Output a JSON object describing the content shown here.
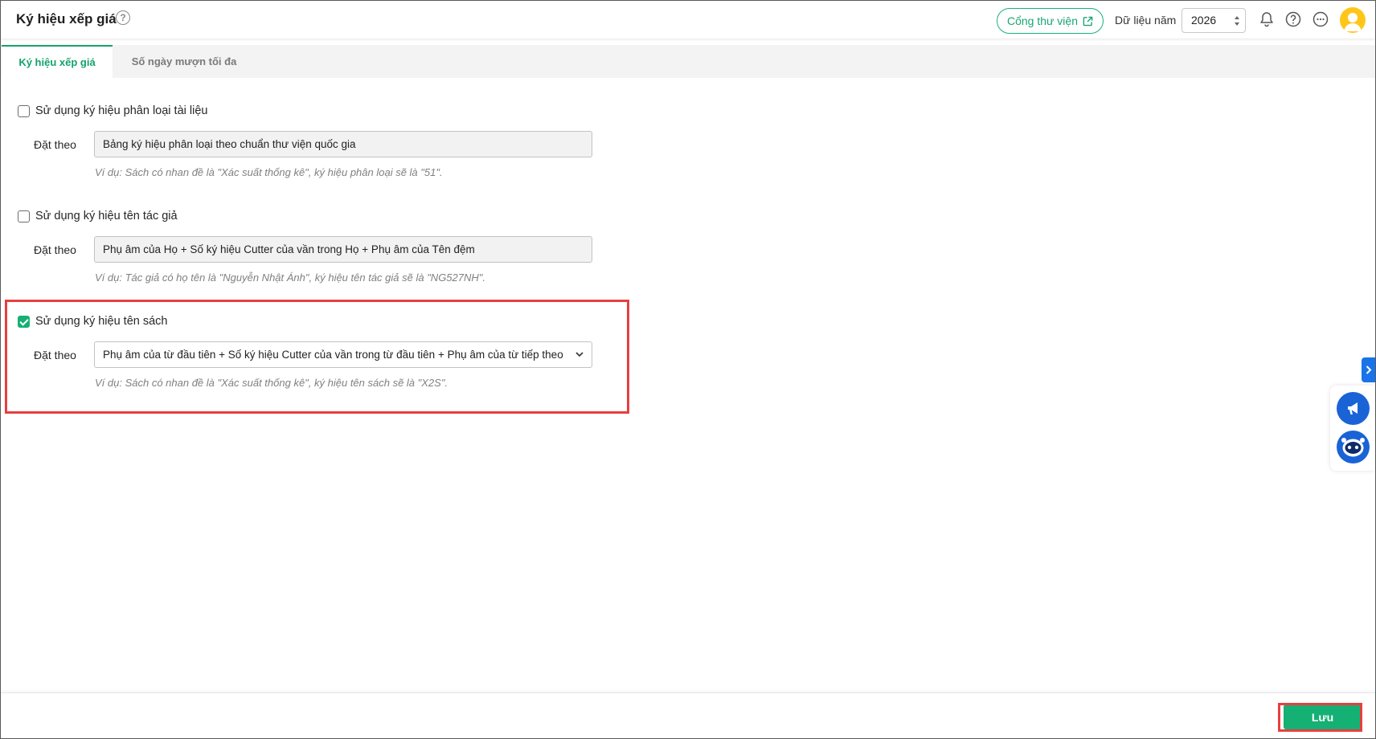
{
  "header": {
    "title": "Ký hiệu xếp giá",
    "help_symbol": "?",
    "portal_button": "Cổng thư viện",
    "year_label": "Dữ liệu năm",
    "year_value": "2026"
  },
  "tabs": [
    {
      "label": "Ký hiệu xếp giá",
      "active": true
    },
    {
      "label": "Số ngày mượn tối đa",
      "active": false
    }
  ],
  "sections": [
    {
      "checkbox_label": "Sử dụng ký hiệu phân loại tài liệu",
      "checked": false,
      "field_label": "Đặt theo",
      "field_value": "Bảng ký hiệu phân loại theo chuẩn thư viện quốc gia",
      "example": "Ví dụ: Sách có nhan đề là \"Xác suất thống kê\", ký hiệu phân loại sẽ là \"51\"."
    },
    {
      "checkbox_label": "Sử dụng ký hiệu tên tác giả",
      "checked": false,
      "field_label": "Đặt theo",
      "field_value": "Phụ âm của Họ + Số ký hiệu Cutter của vần trong Họ + Phụ âm của Tên đệm",
      "example": "Ví dụ: Tác giả có họ tên là \"Nguyễn Nhật Ánh\", ký hiệu tên tác giả sẽ là \"NG527NH\"."
    },
    {
      "checkbox_label": "Sử dụng ký hiệu tên sách",
      "checked": true,
      "field_label": "Đặt theo",
      "field_value": "Phụ âm của từ đầu tiên + Số ký hiệu Cutter của vần trong từ đầu tiên + Phụ âm của từ tiếp theo",
      "example": "Ví dụ: Sách có nhan đề là \"Xác suất thống kê\", ký hiệu tên sách sẽ là \"X2S\"."
    }
  ],
  "footer": {
    "save_label": "Lưu"
  },
  "colors": {
    "accent": "#14b074",
    "highlight": "#e83f3f",
    "side_blue": "#1a63d6"
  },
  "icons": [
    "help-circle-icon",
    "external-link-icon",
    "bell-icon",
    "question-icon",
    "more-icon",
    "user-avatar",
    "chevron-right-icon",
    "megaphone-icon",
    "chatbot-icon",
    "chevron-down-icon"
  ]
}
